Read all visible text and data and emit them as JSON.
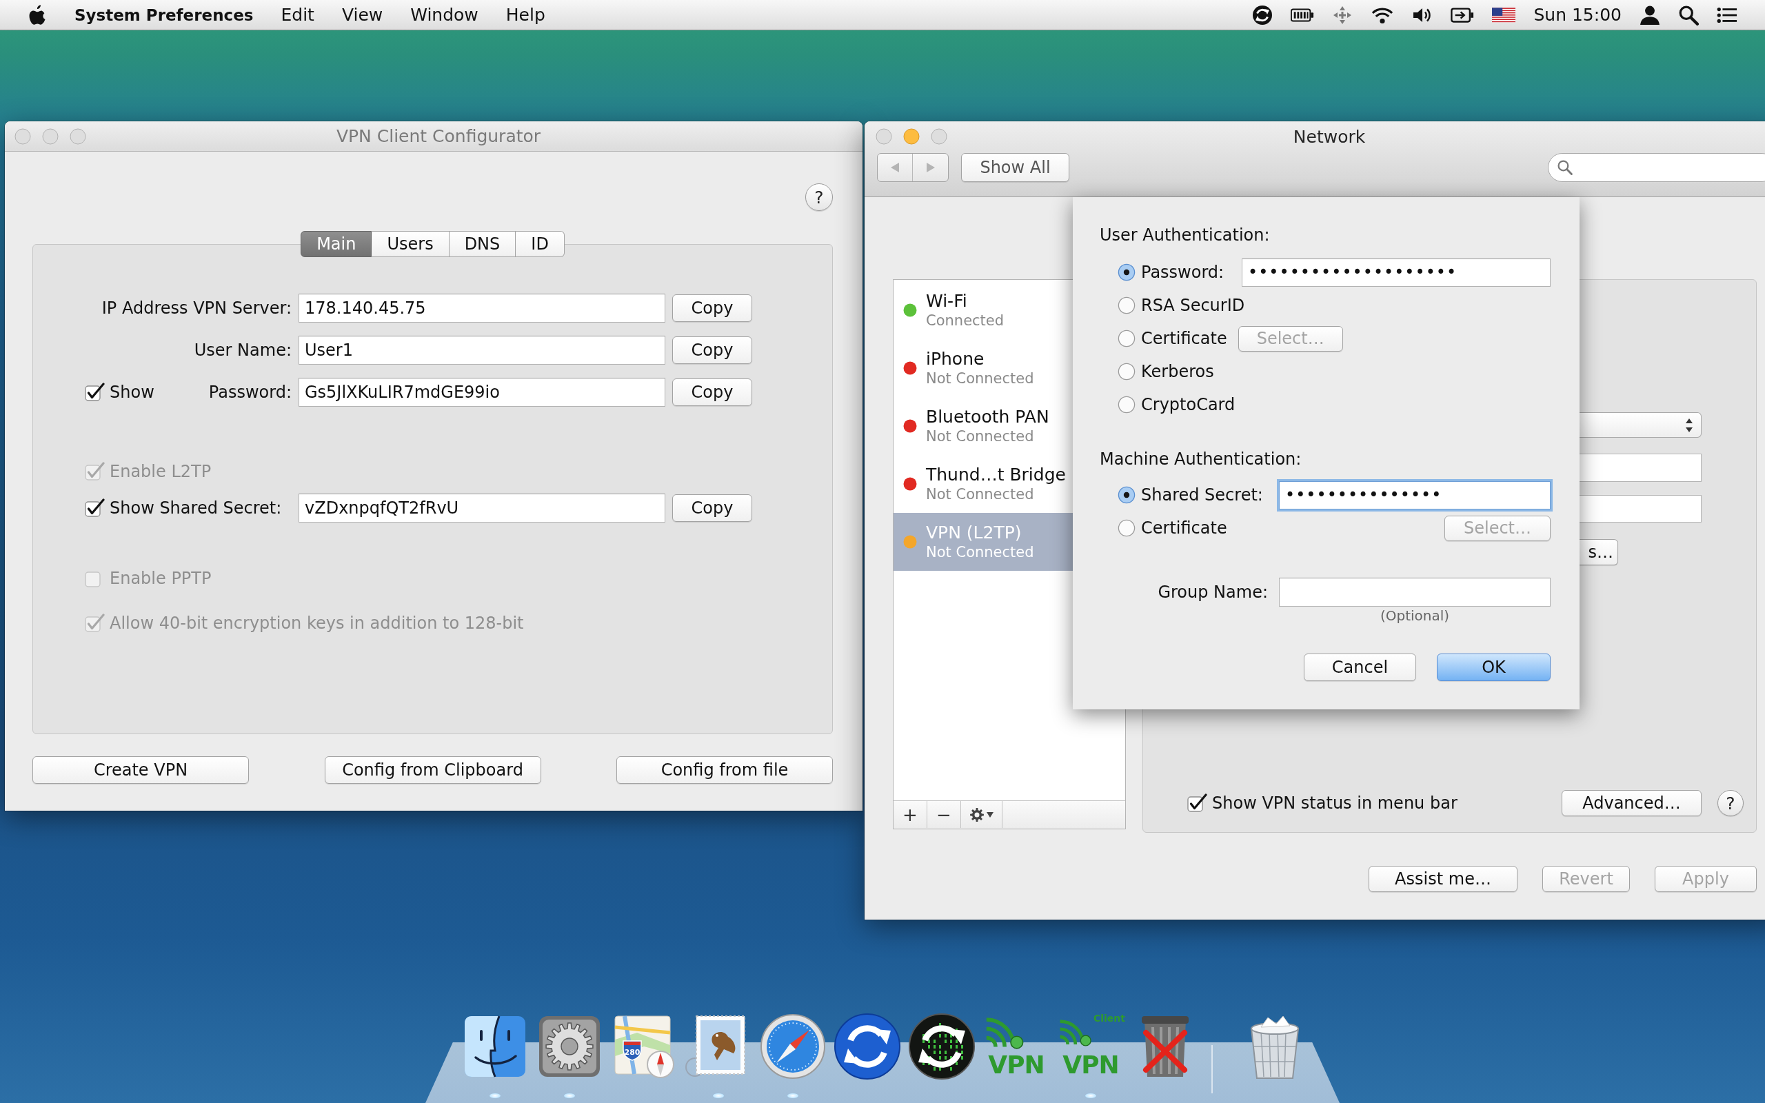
{
  "menu_bar": {
    "app_name": "System Preferences",
    "menus": [
      "Edit",
      "View",
      "Window",
      "Help"
    ],
    "clock": "Sun 15:00"
  },
  "vpn_window": {
    "title": "VPN Client Configurator",
    "window_buttons": [
      {
        "enabled": false
      },
      {
        "enabled": false
      },
      {
        "enabled": false
      }
    ],
    "help": "?",
    "tabs": [
      {
        "label": "Main",
        "selected": true
      },
      {
        "label": "Users",
        "selected": false
      },
      {
        "label": "DNS",
        "selected": false
      },
      {
        "label": "ID",
        "selected": false
      }
    ],
    "fields": [
      {
        "label": "IP Address VPN Server:",
        "value": "178.140.45.75",
        "button": "Copy"
      },
      {
        "label": "User Name:",
        "value": "User1",
        "button": "Copy"
      },
      {
        "label": "Password:",
        "value": "Gs5JlXKuLIR7mdGE99io",
        "button": "Copy",
        "show": {
          "label": "Show",
          "checked": true
        }
      }
    ],
    "options": [
      {
        "kind": "checkbox",
        "label": "Enable L2TP",
        "checked": true,
        "disabled": true
      },
      {
        "kind": "secret",
        "label": "Show Shared Secret:",
        "checked": true,
        "disabled": false,
        "value": "vZDxnpqfQT2fRvU",
        "button": "Copy"
      },
      {
        "kind": "checkbox",
        "label": "Enable PPTP",
        "checked": false,
        "disabled": true
      },
      {
        "kind": "checkbox",
        "label": "Allow 40-bit encryption keys in addition to 128-bit",
        "checked": true,
        "disabled": true
      }
    ],
    "buttons": [
      "Create VPN",
      "Config from Clipboard",
      "Config from file"
    ]
  },
  "network_window": {
    "title": "Network",
    "window_buttons": [
      {
        "enabled": false
      },
      {
        "enabled": true
      },
      {
        "enabled": false
      }
    ],
    "show_all": "Show All",
    "services": [
      {
        "name": "Wi-Fi",
        "status": "Connected",
        "color": "#5cc13a",
        "selected": false
      },
      {
        "name": "iPhone",
        "status": "Not Connected",
        "color": "#e12a22",
        "selected": false
      },
      {
        "name": "Bluetooth PAN",
        "status": "Not Connected",
        "color": "#e12a22",
        "selected": false
      },
      {
        "name": "Thund…t Bridge",
        "status": "Not Connected",
        "color": "#e12a22",
        "selected": false
      },
      {
        "name": "VPN (L2TP)",
        "status": "Not Connected",
        "color": "#f4a62a",
        "selected": true
      }
    ],
    "list_buttons": [
      "+",
      "−"
    ],
    "auth_settings_button": "s…",
    "show_vpn_status": {
      "label": "Show VPN status in menu bar",
      "checked": true
    },
    "advanced_button": "Advanced…",
    "help": "?",
    "buttons": [
      {
        "label": "Assist me…",
        "disabled": false
      },
      {
        "label": "Revert",
        "disabled": true
      },
      {
        "label": "Apply",
        "disabled": true
      }
    ]
  },
  "auth_sheet": {
    "user_heading": "User Authentication:",
    "user_methods": [
      {
        "kind": "field",
        "label": "Password:",
        "value": "••••••••••••••••••••",
        "focused": false,
        "selected": true
      },
      {
        "kind": "plain",
        "label": "RSA SecurID",
        "selected": false
      },
      {
        "kind": "select",
        "label": "Certificate",
        "button": {
          "label": "Select…",
          "disabled": true
        },
        "selected": false
      },
      {
        "kind": "plain",
        "label": "Kerberos",
        "selected": false
      },
      {
        "kind": "plain",
        "label": "CryptoCard",
        "selected": false
      }
    ],
    "machine_heading": "Machine Authentication:",
    "machine_methods": [
      {
        "kind": "field",
        "label": "Shared Secret:",
        "value": "•••••••••••••••",
        "focused": true,
        "selected": true
      },
      {
        "kind": "select",
        "label": "Certificate",
        "button": {
          "label": "Select…",
          "disabled": true
        },
        "selected": false
      }
    ],
    "group_name": {
      "label": "Group Name:",
      "note": "(Optional)"
    },
    "buttons": [
      {
        "label": "Cancel",
        "default": false
      },
      {
        "label": "OK",
        "default": true
      }
    ]
  },
  "dock": {
    "items": [
      {
        "kind": "finder",
        "running": true
      },
      {
        "kind": "settings",
        "running": true
      },
      {
        "kind": "maps",
        "running": false,
        "shield": "280"
      },
      {
        "kind": "mail",
        "running": true
      },
      {
        "kind": "safari",
        "running": true
      },
      {
        "kind": "sync",
        "running": false
      },
      {
        "kind": "binary-sync",
        "running": false
      },
      {
        "kind": "vpn",
        "running": false,
        "logo": "VPN"
      },
      {
        "kind": "vpn-client",
        "running": true,
        "logo": "VPN",
        "caption": "Client"
      },
      {
        "kind": "trash-crossed",
        "running": false
      },
      {
        "kind": "trash",
        "running": false
      }
    ]
  }
}
